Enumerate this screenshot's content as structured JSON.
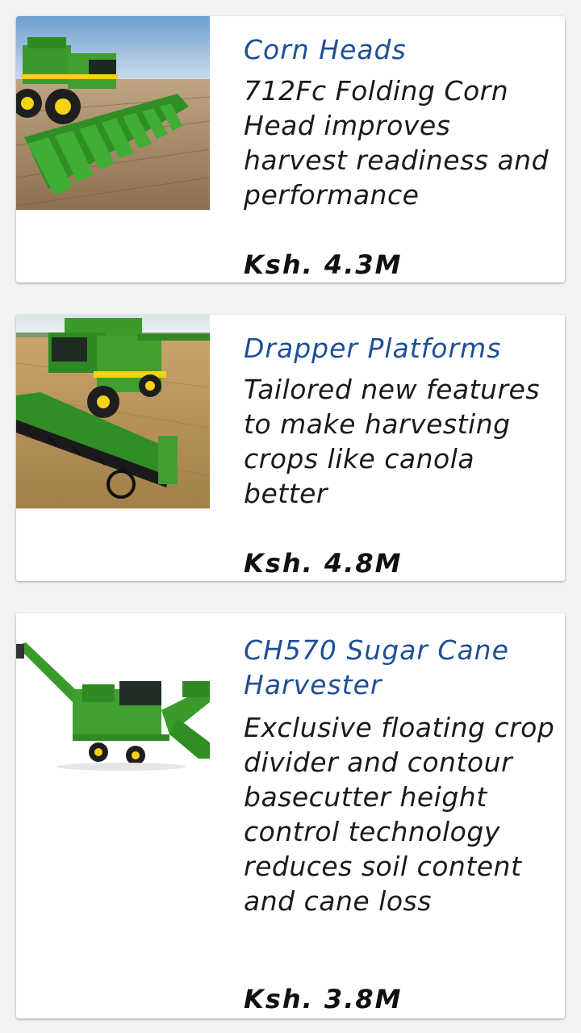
{
  "products": [
    {
      "title": "Corn Heads",
      "description": "712Fc Folding Corn Head improves harvest readiness and performance",
      "price": "Ksh. 4.3M",
      "image_icon": "combine-corn-head-photo"
    },
    {
      "title": "Drapper Platforms",
      "description": "Tailored new features to make harvesting crops like canola better",
      "price": "Ksh. 4.8M",
      "image_icon": "combine-draper-platform-photo"
    },
    {
      "title": "CH570 Sugar Cane Harvester",
      "description": "Exclusive floating crop divider and contour basecutter height control technology reduces soil content and cane loss",
      "price": "Ksh. 3.8M",
      "image_icon": "sugar-cane-harvester-photo"
    }
  ],
  "colors": {
    "title": "#1f4e95",
    "text": "#1a1a1a",
    "background": "#f3f3f3",
    "card": "#ffffff",
    "brand_green": "#3a9b2a",
    "brand_yellow": "#f5d312"
  }
}
